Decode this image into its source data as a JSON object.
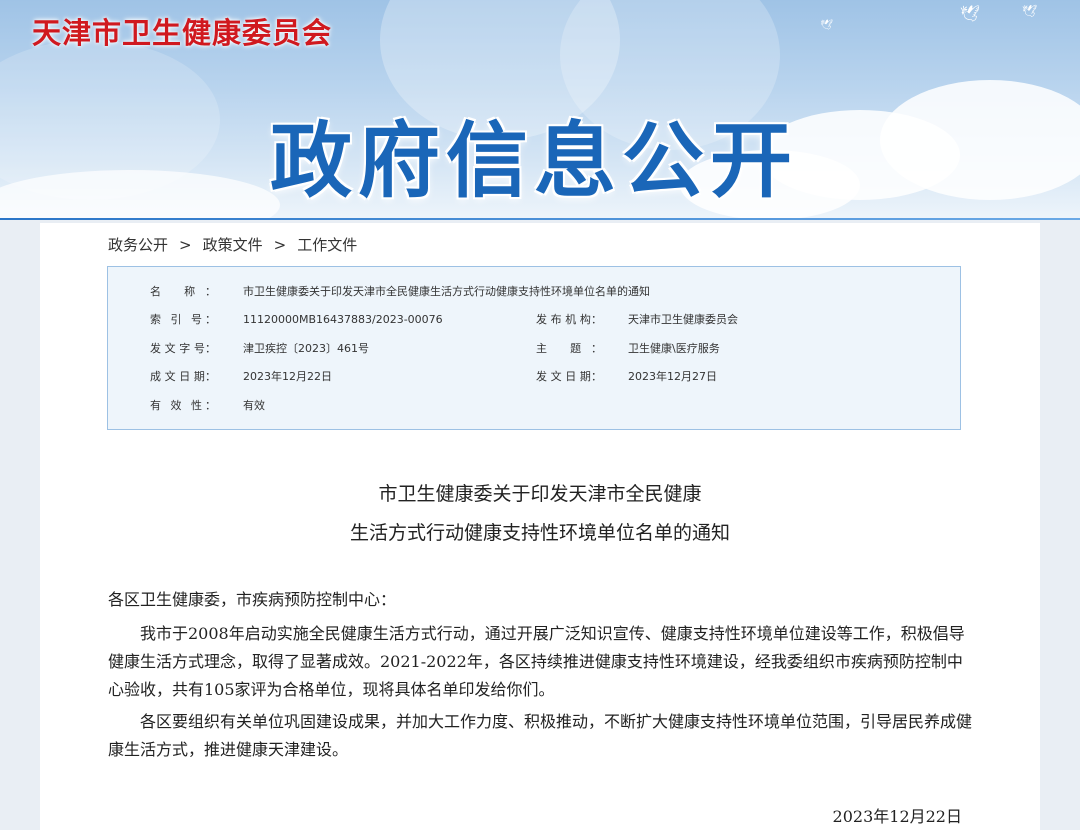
{
  "header": {
    "org_name": "天津市卫生健康委员会",
    "banner_title": "政府信息公开"
  },
  "breadcrumb": [
    "政务公开",
    "政策文件",
    "工作文件"
  ],
  "breadcrumb_sep": ">",
  "meta": {
    "name_label": "名 称：",
    "name_value": "市卫生健康委关于印发天津市全民健康生活方式行动健康支持性环境单位名单的通知",
    "index_label": "索 引 号：",
    "index_value": "11120000MB16437883/2023-00076",
    "issuer_label": "发 布 机 构：",
    "issuer_value": "天津市卫生健康委员会",
    "docno_label": "发 文 字 号：",
    "docno_value": "津卫疾控〔2023〕461号",
    "topic_label": "主 题：",
    "topic_value": "卫生健康\\医疗服务",
    "created_label": "成 文 日 期：",
    "created_value": "2023年12月22日",
    "published_label": "发 文 日 期：",
    "published_value": "2023年12月27日",
    "validity_label": "有 效 性：",
    "validity_value": "有效"
  },
  "doc": {
    "title_line1": "市卫生健康委关于印发天津市全民健康",
    "title_line2": "生活方式行动健康支持性环境单位名单的通知",
    "salutation": "各区卫生健康委，市疾病预防控制中心：",
    "para1": "我市于2008年启动实施全民健康生活方式行动，通过开展广泛知识宣传、健康支持性环境单位建设等工作，积极倡导健康生活方式理念，取得了显著成效。2021-2022年，各区持续推进健康支持性环境建设，经我委组织市疾病预防控制中心验收，共有105家评为合格单位，现将具体名单印发给你们。",
    "para2": "各区要组织有关单位巩固建设成果，并加大工作力度、积极推动，不断扩大健康支持性环境单位范围，引导居民养成健康生活方式，推进健康天津建设。",
    "date": "2023年12月22日"
  }
}
